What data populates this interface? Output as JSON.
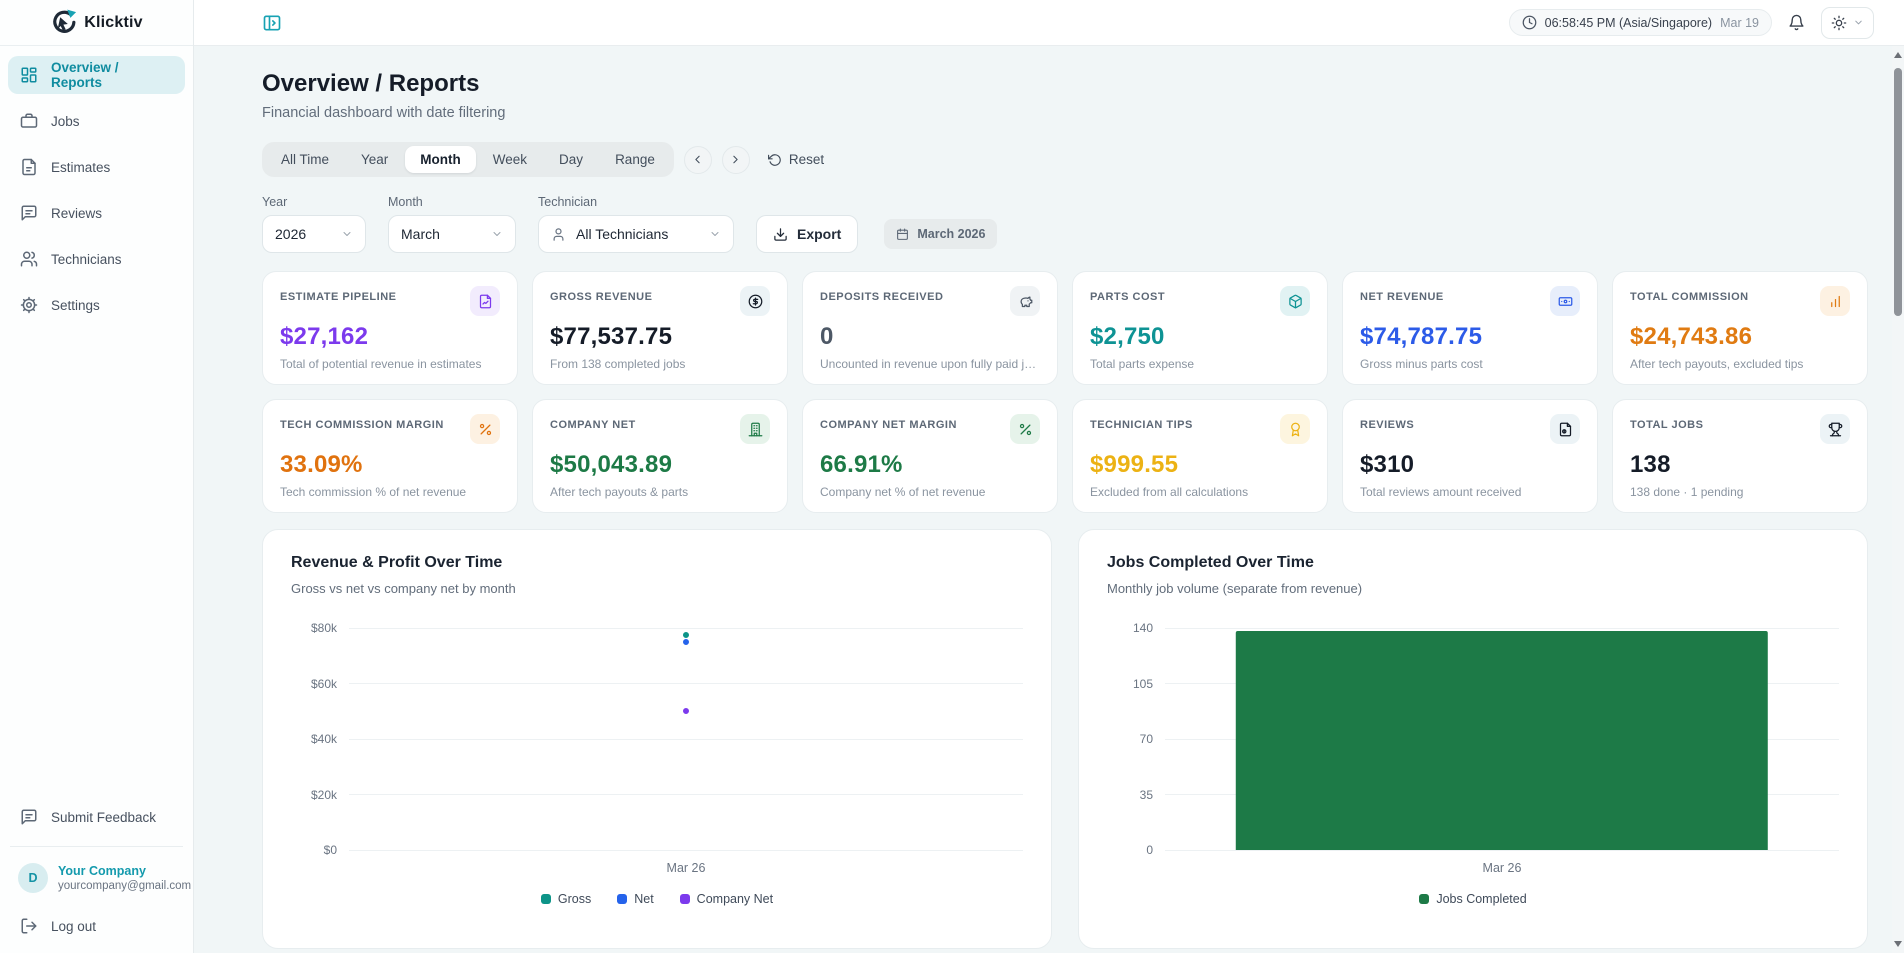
{
  "brand": {
    "name": "Klicktiv",
    "accent_color": "#17a2b3"
  },
  "topbar": {
    "clock_time": "06:58:45 PM (Asia/Singapore)",
    "clock_date": "Mar 19"
  },
  "sidebar": {
    "items": [
      {
        "label": "Overview / Reports",
        "icon": "dashboard-icon",
        "active": true
      },
      {
        "label": "Jobs",
        "icon": "briefcase-icon",
        "active": false
      },
      {
        "label": "Estimates",
        "icon": "file-text-icon",
        "active": false
      },
      {
        "label": "Reviews",
        "icon": "message-square-icon",
        "active": false
      },
      {
        "label": "Technicians",
        "icon": "users-icon",
        "active": false
      },
      {
        "label": "Settings",
        "icon": "gear-icon",
        "active": false
      }
    ],
    "feedback_label": "Submit Feedback",
    "account": {
      "initial": "D",
      "company": "Your Company",
      "email": "yourcompany@gmail.com"
    },
    "logout_label": "Log out"
  },
  "page": {
    "title": "Overview / Reports",
    "subtitle": "Financial dashboard with date filtering"
  },
  "filters": {
    "tabs": [
      "All Time",
      "Year",
      "Month",
      "Week",
      "Day",
      "Range"
    ],
    "active_tab": "Month",
    "reset_label": "Reset",
    "year_label": "Year",
    "year_value": "2026",
    "month_label": "Month",
    "month_value": "March",
    "technician_label": "Technician",
    "technician_value": "All Technicians",
    "export_label": "Export",
    "period_badge": "March 2026"
  },
  "stats": [
    {
      "label": "ESTIMATE PIPELINE",
      "value": "$27,162",
      "sub": "Total of potential revenue in estimates",
      "color": "#7c3aed",
      "chip_bg": "#f2ecfd",
      "icon": "file-chart-icon"
    },
    {
      "label": "GROSS REVENUE",
      "value": "$77,537.75",
      "sub": "From 138 completed jobs",
      "color": "#151c28",
      "chip_bg": "#ecf3f6",
      "icon": "dollar-circle-icon"
    },
    {
      "label": "DEPOSITS RECEIVED",
      "value": "0",
      "sub": "Uncounted in revenue upon fully paid j…",
      "color": "#4d5866",
      "chip_bg": "#f0f3f5",
      "icon": "piggy-bank-icon"
    },
    {
      "label": "PARTS COST",
      "value": "$2,750",
      "sub": "Total parts expense",
      "color": "#0e9394",
      "chip_bg": "#e1f2f3",
      "icon": "package-icon"
    },
    {
      "label": "NET REVENUE",
      "value": "$74,787.75",
      "sub": "Gross minus parts cost",
      "color": "#2c5be8",
      "chip_bg": "#e7eefb",
      "icon": "banknote-icon"
    },
    {
      "label": "TOTAL COMMISSION",
      "value": "$24,743.86",
      "sub": "After tech payouts, excluded tips",
      "color": "#e07b12",
      "chip_bg": "#fdf1e2",
      "icon": "bar-chart-icon"
    },
    {
      "label": "TECH COMMISSION MARGIN",
      "value": "33.09%",
      "sub": "Tech commission % of net revenue",
      "color": "#e0720e",
      "chip_bg": "#fdf1e2",
      "icon": "percent-icon"
    },
    {
      "label": "COMPANY NET",
      "value": "$50,043.89",
      "sub": "After tech payouts & parts",
      "color": "#1d7a46",
      "chip_bg": "#e6f3ea",
      "icon": "building-icon"
    },
    {
      "label": "COMPANY NET MARGIN",
      "value": "66.91%",
      "sub": "Company net % of net revenue",
      "color": "#1d7a46",
      "chip_bg": "#e6f3ea",
      "icon": "percent-icon"
    },
    {
      "label": "TECHNICIAN TIPS",
      "value": "$999.55",
      "sub": "Excluded from all calculations",
      "color": "#ecb214",
      "chip_bg": "#fdf5df",
      "icon": "award-icon"
    },
    {
      "label": "REVIEWS",
      "value": "$310",
      "sub": "Total reviews amount received",
      "color": "#151c28",
      "chip_bg": "#ecf3f6",
      "icon": "file-coin-icon"
    },
    {
      "label": "TOTAL JOBS",
      "value": "138",
      "sub": "138 done · 1 pending",
      "color": "#151c28",
      "chip_bg": "#ecf3f6",
      "icon": "trophy-icon"
    }
  ],
  "chart_data": [
    {
      "type": "scatter",
      "title": "Revenue & Profit Over Time",
      "subtitle": "Gross vs net vs company net by month",
      "x": [
        "Mar 26"
      ],
      "series": [
        {
          "name": "Gross",
          "values": [
            77537.75
          ],
          "color": "#0d9488"
        },
        {
          "name": "Net",
          "values": [
            74787.75
          ],
          "color": "#2563eb"
        },
        {
          "name": "Company Net",
          "values": [
            50043.89
          ],
          "color": "#7c3aed"
        }
      ],
      "ylim": [
        0,
        80000
      ],
      "ytick_labels": [
        "$80k",
        "$60k",
        "$40k",
        "$20k",
        "$0"
      ],
      "grid": true,
      "legend_position": "bottom"
    },
    {
      "type": "bar",
      "title": "Jobs Completed Over Time",
      "subtitle": "Monthly job volume (separate from revenue)",
      "categories": [
        "Mar 26"
      ],
      "series": [
        {
          "name": "Jobs Completed",
          "values": [
            138
          ],
          "color": "#1d7a47"
        }
      ],
      "ylim": [
        0,
        140
      ],
      "ytick_labels": [
        "140",
        "105",
        "70",
        "35",
        "0"
      ],
      "grid": true,
      "legend_position": "bottom"
    }
  ]
}
